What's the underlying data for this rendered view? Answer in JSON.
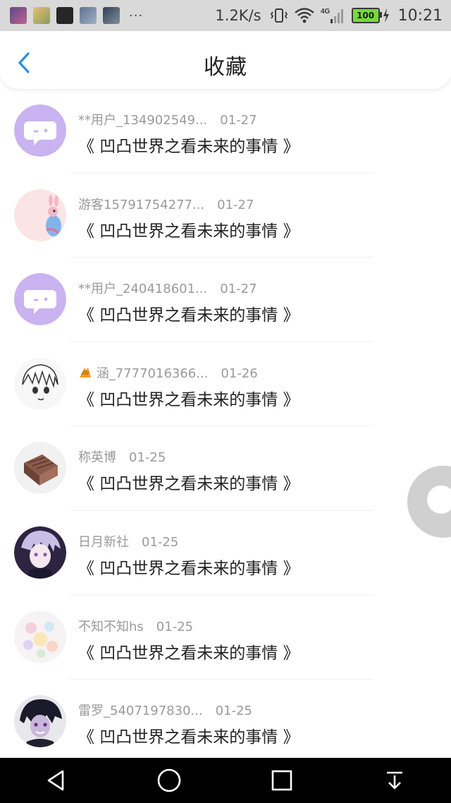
{
  "status_bar": {
    "more": "···",
    "net_speed": "1.2K/s",
    "network_type": "4G",
    "battery": "100",
    "time": "10:21"
  },
  "header": {
    "title": "收藏"
  },
  "items": [
    {
      "user": "**用户_134902549...",
      "date": "01-27",
      "title": "《 凹凸世界之看未来的事情 》",
      "avatar": "chat-bubble"
    },
    {
      "user": "游客15791754277...",
      "date": "01-27",
      "title": "《 凹凸世界之看未来的事情 》",
      "avatar": "cartoon-pony"
    },
    {
      "user": "**用户_240418601...",
      "date": "01-27",
      "title": "《 凹凸世界之看未来的事情 》",
      "avatar": "chat-bubble"
    },
    {
      "user": "涵_7777016366...",
      "date": "01-26",
      "title": "《 凹凸世界之看未来的事情 》",
      "avatar": "anime-sketch",
      "badge": "pinecone-emoji"
    },
    {
      "user": "称英博",
      "date": "01-25",
      "title": "《 凹凸世界之看未来的事情 》",
      "avatar": "brown-box"
    },
    {
      "user": "日月新社",
      "date": "01-25",
      "title": "《 凹凸世界之看未来的事情 》",
      "avatar": "anime-character"
    },
    {
      "user": "不知不知hs",
      "date": "01-25",
      "title": "《 凹凸世界之看未来的事情 》",
      "avatar": "pastel-flowers"
    },
    {
      "user": "雷罗_5407197830...",
      "date": "01-25",
      "title": "《 凹凸世界之看未来的事情 》",
      "avatar": "anime-character-dark"
    }
  ]
}
